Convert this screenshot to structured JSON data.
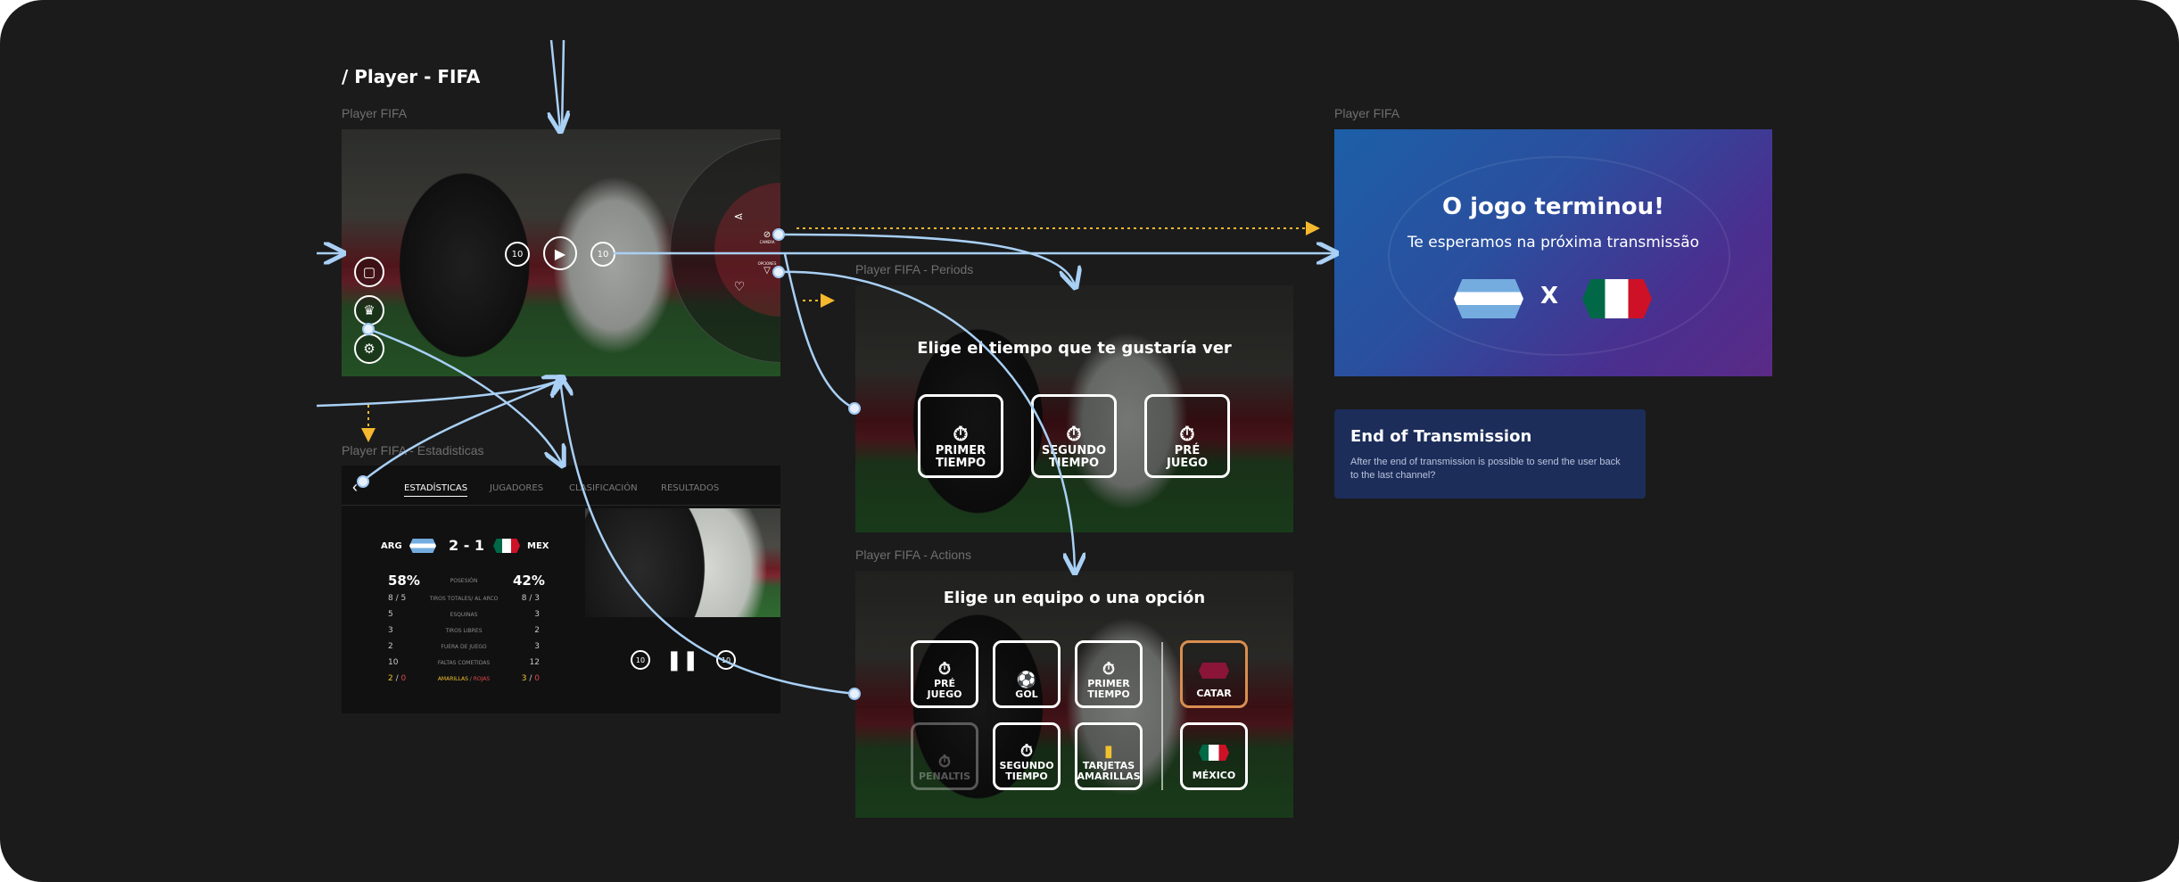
{
  "heading": "/ Player - FIFA",
  "frames": {
    "player_label": "Player FIFA",
    "periods_label": "Player FIFA - Periods",
    "stats_label": "Player FIFA - Estadisticas",
    "actions_label": "Player FIFA - Actions",
    "end_label": "Player FIFA"
  },
  "player": {
    "rewind": "10",
    "forward": "10",
    "share_caption": "CAMERA",
    "options_caption": "OPCIONES"
  },
  "periods": {
    "title": "Elige el tiempo que te gustaría ver",
    "options": [
      {
        "icon": "stopwatch-icon",
        "line1": "PRIMER",
        "line2": "TIEMPO"
      },
      {
        "icon": "stopwatch-icon",
        "line1": "SEGUNDO",
        "line2": "TIEMPO"
      },
      {
        "icon": "stopwatch-icon",
        "line1": "PRÉ",
        "line2": "JUEGO"
      }
    ]
  },
  "actions": {
    "title": "Elige un equipo o una opción",
    "options": [
      {
        "line1": "PRÉ",
        "line2": "JUEGO"
      },
      {
        "line1": "GOL",
        "line2": ""
      },
      {
        "line1": "PRIMER",
        "line2": "TIEMPO"
      },
      {
        "line1": "PENALTIS",
        "line2": ""
      },
      {
        "line1": "SEGUNDO",
        "line2": "TIEMPO"
      },
      {
        "line1": "TARJETAS",
        "line2": "AMARILLAS"
      }
    ],
    "teams": [
      {
        "name": "CATAR",
        "color": "#8a1538"
      },
      {
        "name": "MÉXICO",
        "color": "#006847"
      }
    ]
  },
  "stats": {
    "tabs": [
      "ESTADÍSTICAS",
      "JUGADORES",
      "CLASIFICACIÓN",
      "RESULTADOS"
    ],
    "home": "ARG",
    "away": "MEX",
    "score": "2 - 1",
    "possession_home": "58%",
    "possession_label": "POSESIÓN",
    "possession_away": "42%",
    "rows": [
      {
        "l": "8 / 5",
        "m": "TIROS TOTALES/ AL ARCO",
        "r": "8 / 3"
      },
      {
        "l": "5",
        "m": "ESQUINAS",
        "r": "3"
      },
      {
        "l": "3",
        "m": "TIROS LIBRES",
        "r": "2"
      },
      {
        "l": "2",
        "m": "FUERA DE JUEGO",
        "r": "3"
      },
      {
        "l": "10",
        "m": "FALTAS COMETIDAS",
        "r": "12"
      }
    ],
    "cards_home_y": "2",
    "cards_home_r": "0",
    "cards_label_y": "AMARILLAS",
    "cards_label_sep": " / ",
    "cards_label_r": "ROJAS",
    "cards_away_y": "3",
    "cards_away_r": "0",
    "mini_rewind": "10",
    "mini_forward": "10"
  },
  "end_screen": {
    "title": "O jogo terminou!",
    "subtitle": "Te esperamos na próxima transmissão",
    "versus": "X"
  },
  "end_card": {
    "title": "End of Transmission",
    "body": "After the end of transmission is possible to send the user back to the last channel?"
  },
  "colors": {
    "background": "#1b1b1b",
    "connector": "#a9d0f5",
    "dashed_connector": "#f5b82e",
    "card": "#1c2d5a"
  }
}
